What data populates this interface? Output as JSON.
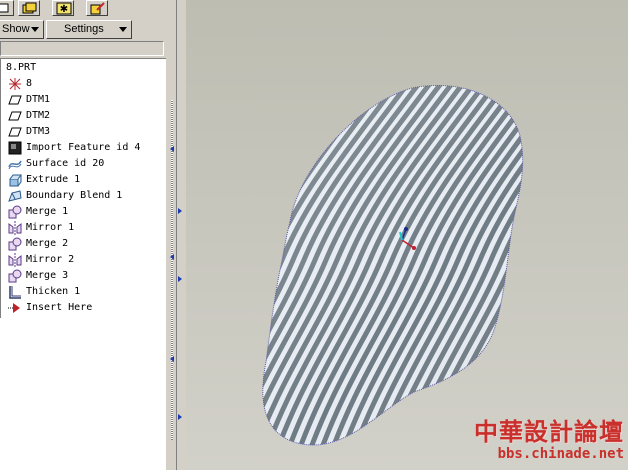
{
  "toolbar": {
    "show_label": "Show",
    "settings_label": "Settings"
  },
  "tree": {
    "root": "8.PRT",
    "items": [
      {
        "label": "8",
        "icon": "csys-icon"
      },
      {
        "label": "DTM1",
        "icon": "datum-plane-icon"
      },
      {
        "label": "DTM2",
        "icon": "datum-plane-icon"
      },
      {
        "label": "DTM3",
        "icon": "datum-plane-icon"
      },
      {
        "label": "Import Feature id 4",
        "icon": "import-feature-icon"
      },
      {
        "label": "Surface id 20",
        "icon": "surface-icon"
      },
      {
        "label": "Extrude 1",
        "icon": "extrude-icon"
      },
      {
        "label": "Boundary Blend 1",
        "icon": "boundary-blend-icon"
      },
      {
        "label": "Merge 1",
        "icon": "merge-icon"
      },
      {
        "label": "Mirror 1",
        "icon": "mirror-icon"
      },
      {
        "label": "Merge 2",
        "icon": "merge-icon"
      },
      {
        "label": "Mirror 2",
        "icon": "mirror-icon"
      },
      {
        "label": "Merge 3",
        "icon": "merge-icon"
      },
      {
        "label": "Thicken 1",
        "icon": "thicken-icon"
      },
      {
        "label": "Insert Here",
        "icon": "insert-here-arrow-icon"
      }
    ]
  },
  "watermark": {
    "cn": "中華設計論壇",
    "url": "bbs.chinade.net"
  },
  "colors": {
    "stripe_light": "#e6ecf2",
    "stripe_dark": "#6f7b84",
    "accent_blue": "#1a3cb0",
    "watermark_red": "#c9302c"
  }
}
